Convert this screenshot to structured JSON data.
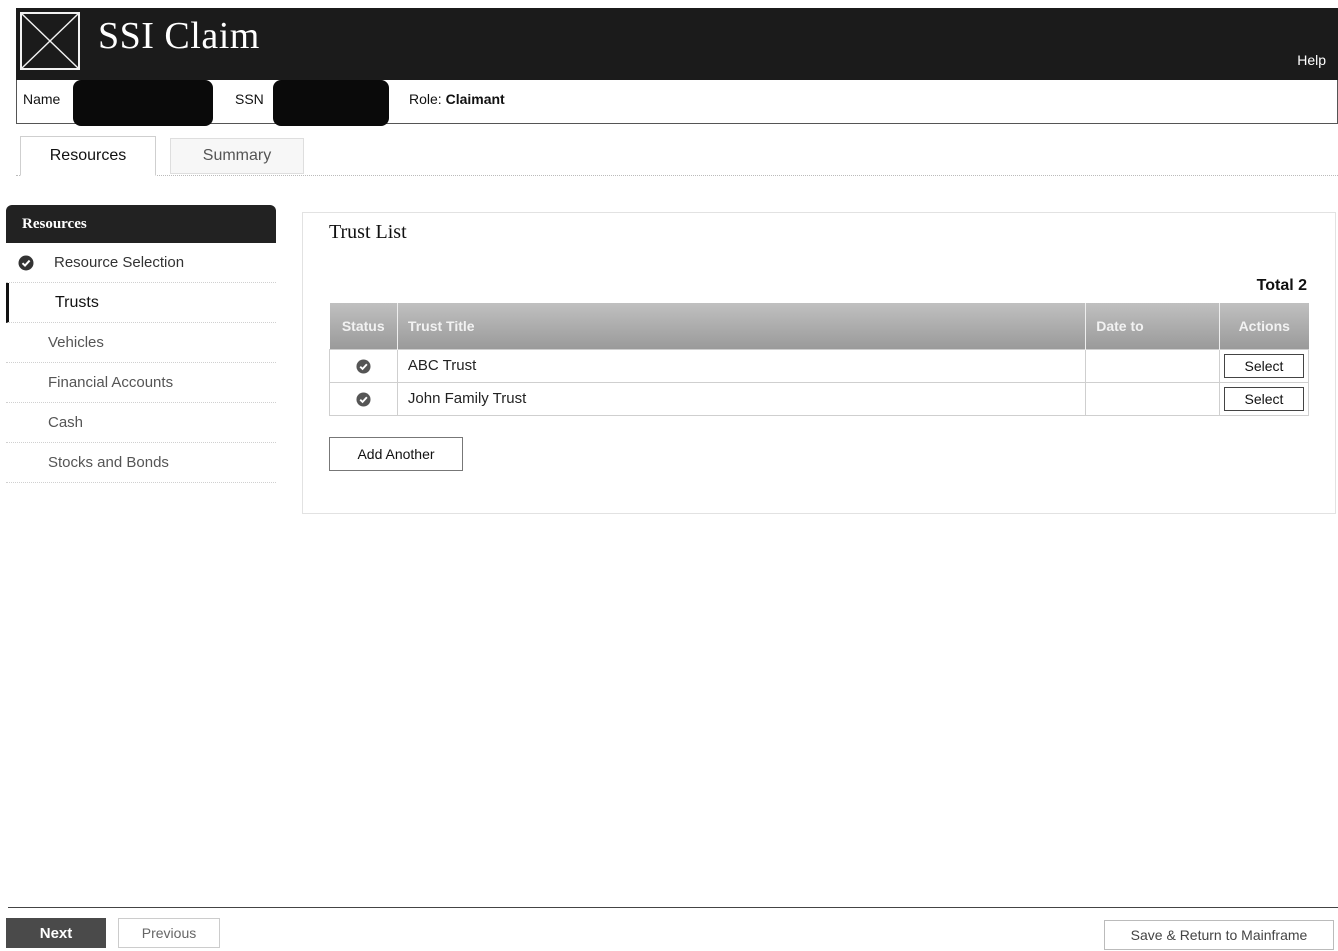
{
  "header": {
    "title": "SSI Claim",
    "help_label": "Help",
    "logo_icon": "x-box-logo"
  },
  "info_bar": {
    "name_label": "Name",
    "ssn_label": "SSN",
    "role_label": "Role:",
    "role_value": "Claimant"
  },
  "tabs": [
    {
      "label": "Resources",
      "active": true
    },
    {
      "label": "Summary",
      "active": false
    }
  ],
  "sidebar": {
    "header": "Resources",
    "items": [
      {
        "label": "Resource Selection",
        "icon": "check-circle-icon",
        "complete": true
      },
      {
        "label": "Trusts",
        "active": true
      },
      {
        "label": "Vehicles"
      },
      {
        "label": "Financial Accounts"
      },
      {
        "label": "Cash"
      },
      {
        "label": "Stocks and Bonds"
      }
    ]
  },
  "main": {
    "title": "Trust List",
    "total_label": "Total 2",
    "columns": [
      "Status",
      "Trust Title",
      "Date to",
      "Actions"
    ],
    "rows": [
      {
        "status_icon": "check-circle-icon",
        "title": "ABC Trust",
        "date": "",
        "action": "Select"
      },
      {
        "status_icon": "check-circle-icon",
        "title": "John Family Trust",
        "date": "",
        "action": "Select"
      }
    ],
    "add_label": "Add Another"
  },
  "footer": {
    "next_label": "Next",
    "previous_label": "Previous",
    "save_label": "Save & Return to Mainframe"
  },
  "colors": {
    "header_bg": "#1b1b1b",
    "table_header_bg": "#a8a8a8",
    "next_bg": "#4a4a4a"
  }
}
